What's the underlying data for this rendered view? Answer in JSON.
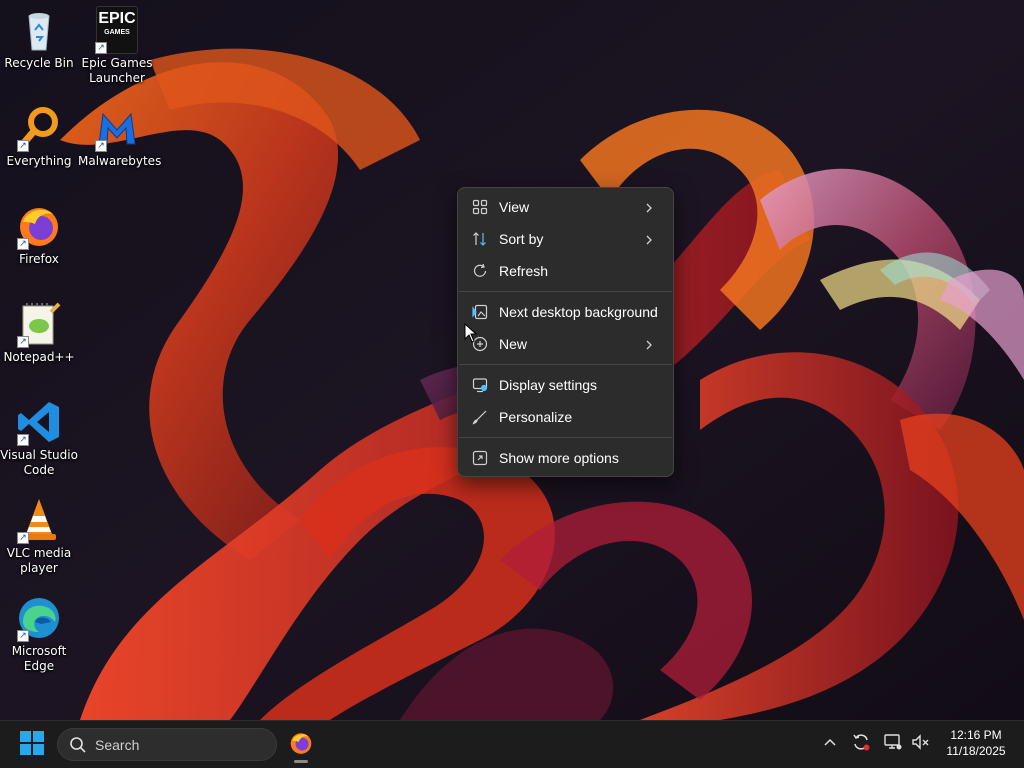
{
  "desktop": {
    "icons": [
      {
        "label": "Recycle Bin",
        "icon": "recycle-bin-icon",
        "shortcut": false
      },
      {
        "label": "Epic Games Launcher",
        "icon": "epic-games-icon",
        "logo_lines": [
          "EPIC",
          "GAMES"
        ],
        "shortcut": true
      },
      {
        "label": "Everything",
        "icon": "everything-search-icon",
        "shortcut": true
      },
      {
        "label": "Malwarebytes",
        "icon": "malwarebytes-icon",
        "shortcut": true
      },
      {
        "label": "Firefox",
        "icon": "firefox-icon",
        "shortcut": true
      },
      {
        "label": "Notepad++",
        "icon": "notepadpp-icon",
        "shortcut": true
      },
      {
        "label": "Visual Studio Code",
        "icon": "vscode-icon",
        "shortcut": true
      },
      {
        "label": "VLC media player",
        "icon": "vlc-icon",
        "shortcut": true
      },
      {
        "label": "Microsoft Edge",
        "icon": "edge-icon",
        "shortcut": true
      }
    ]
  },
  "context_menu": {
    "items": [
      {
        "label": "View",
        "icon": "grid-view-icon",
        "submenu": true
      },
      {
        "label": "Sort by",
        "icon": "sort-icon",
        "submenu": true
      },
      {
        "label": "Refresh",
        "icon": "refresh-icon",
        "submenu": false
      },
      {
        "label": "Next desktop background",
        "icon": "next-background-icon",
        "submenu": false
      },
      {
        "label": "New",
        "icon": "new-plus-icon",
        "submenu": true
      },
      {
        "label": "Display settings",
        "icon": "display-settings-icon",
        "submenu": false
      },
      {
        "label": "Personalize",
        "icon": "brush-icon",
        "submenu": false
      },
      {
        "label": "Show more options",
        "icon": "show-more-icon",
        "submenu": false
      }
    ]
  },
  "taskbar": {
    "search_placeholder": "Search",
    "pinned": [
      {
        "name": "Firefox",
        "icon": "firefox-icon",
        "running": true
      }
    ],
    "tray_icons": [
      "chevron-up-icon",
      "sync-icon",
      "network-icon",
      "volume-muted-icon"
    ],
    "clock": {
      "time": "12:16 PM",
      "date": "11/18/2025"
    }
  },
  "colors": {
    "menu_bg": "#2c2c2c",
    "taskbar_bg": "#1c1c1c",
    "accent": "#4cc2ff",
    "win_blue": "#2aa7ea"
  }
}
